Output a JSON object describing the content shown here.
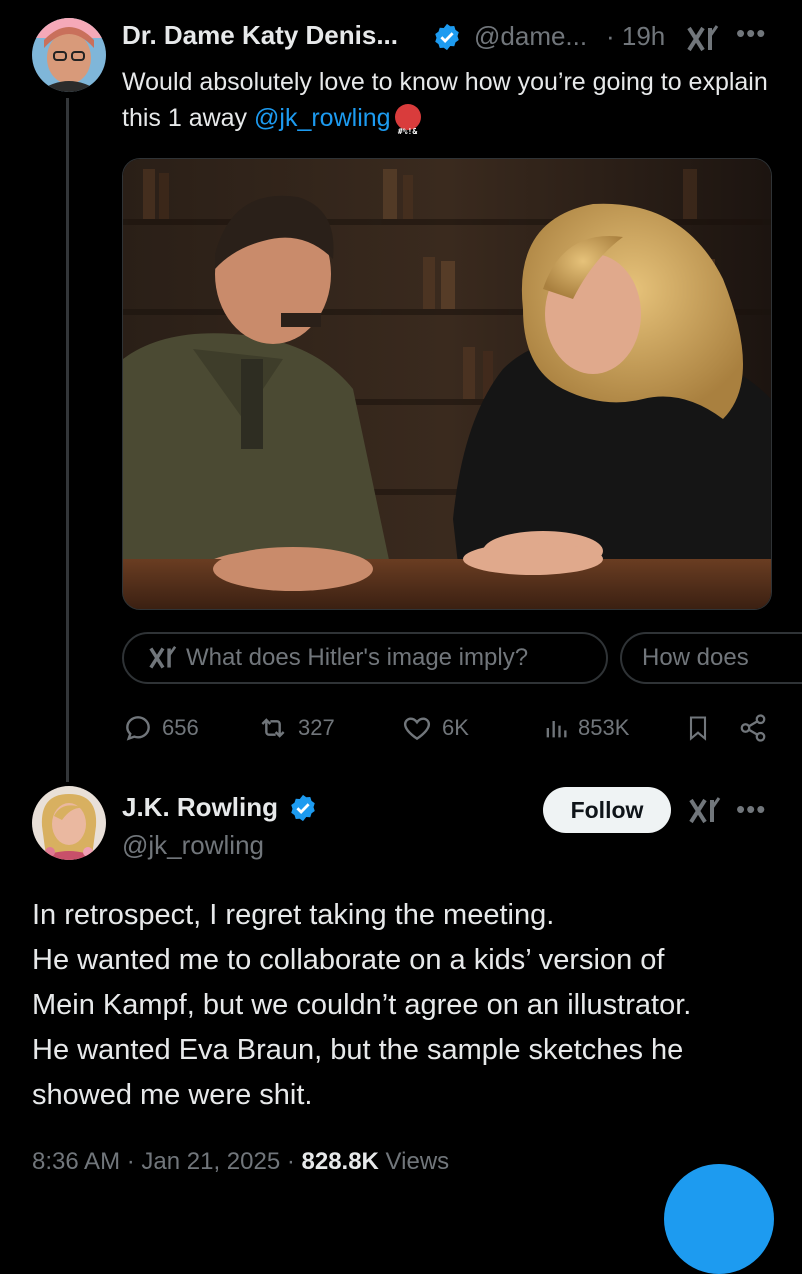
{
  "colors": {
    "accent": "#1d9bf0",
    "muted": "#71767b",
    "text": "#e7e9ea",
    "background": "#000000"
  },
  "tweet1": {
    "author_name": "Dr. Dame Katy Denis...",
    "handle": "@dame...",
    "time": "· 19h",
    "text_before": "Would absolutely love to know how you’re going to explain this 1 away ",
    "mention": "@jk_rowling",
    "emoji_text": "#%!&",
    "grok_chips": [
      "What does Hitler's image imply?",
      "How does"
    ],
    "actions": {
      "replies": "656",
      "reposts": "327",
      "likes": "6K",
      "views": "853K"
    }
  },
  "tweet2": {
    "author_name": "J.K. Rowling",
    "handle": "@jk_rowling",
    "follow_label": "Follow",
    "lines": [
      "In retrospect, I regret taking the meeting.",
      "He wanted me to collaborate on a kids’ version of",
      "Mein Kampf, but we couldn’t agree on an illustrator.",
      "He wanted Eva Braun, but the sample sketches he",
      "showed me were shit."
    ],
    "timestamp": "8:36 AM · Jan 21, 2025 · ",
    "views_count": "828.8K",
    "views_label": " Views"
  },
  "icons": [
    "verified-badge-icon",
    "grok-icon",
    "more-icon",
    "reply-icon",
    "repost-icon",
    "like-icon",
    "views-icon",
    "bookmark-icon",
    "share-icon"
  ]
}
